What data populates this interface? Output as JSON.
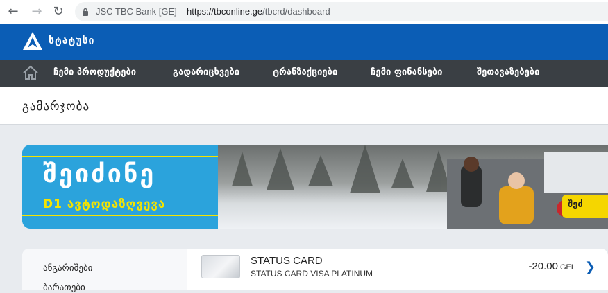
{
  "browser": {
    "site_identity": "JSC TBC Bank [GE]",
    "url_host": "https://tbconline.ge",
    "url_path": "/tbcrd/dashboard"
  },
  "brand": {
    "name": "სტატუსი"
  },
  "nav": {
    "items": [
      {
        "label": "ჩემი პროდუქტები"
      },
      {
        "label": "გადარიცხვები"
      },
      {
        "label": "ტრანზაქციები"
      },
      {
        "label": "ჩემი ფინანსები"
      },
      {
        "label": "შეთავაზებები"
      }
    ]
  },
  "page": {
    "title": "გამარჯობა"
  },
  "banner": {
    "headline": "შეიძინე",
    "subline": "D1 ავტოდაზღვევა",
    "cta_partial": "შეძ"
  },
  "sidebar": {
    "items": [
      {
        "label": "ანგარიშები"
      },
      {
        "label": "ბარათები"
      }
    ]
  },
  "card": {
    "name": "STATUS CARD",
    "subtitle": "STATUS CARD VISA PLATINUM",
    "amount": "-20.00",
    "currency": "GEL"
  },
  "colors": {
    "brand_blue": "#0b5db5",
    "nav_dark": "#3a3f44",
    "banner_blue": "#2ba3dc",
    "banner_yellow": "#f5e400"
  }
}
